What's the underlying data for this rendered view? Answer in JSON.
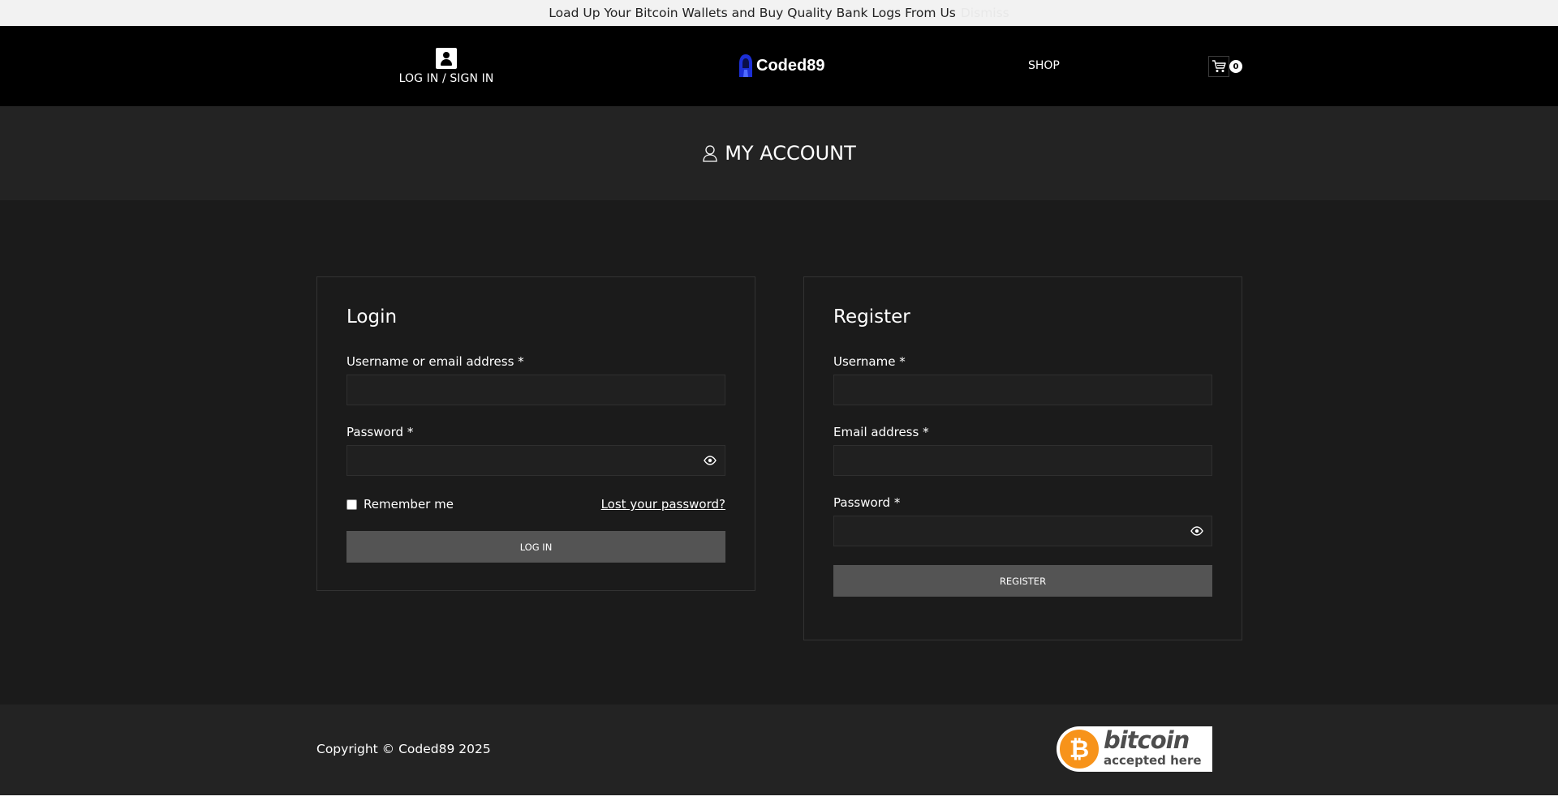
{
  "announcement": {
    "text": "Load Up Your Bitcoin Wallets and Buy Quality Bank Logs From Us",
    "link": "Dismiss"
  },
  "header": {
    "login_label": "LOG IN / SIGN IN",
    "logo_text": "Coded89",
    "shop_label": "SHOP",
    "cart_count": "0"
  },
  "hero": {
    "title": "MY ACCOUNT"
  },
  "login": {
    "heading": "Login",
    "username_label": "Username or email address *",
    "password_label": "Password *",
    "remember_label": "Remember me",
    "lost_password": "Lost your password?",
    "submit": "LOG IN"
  },
  "register": {
    "heading": "Register",
    "username_label": "Username *",
    "email_label": "Email address *",
    "password_label": "Password *",
    "submit": "REGISTER"
  },
  "footer": {
    "copyright": "Copyright © Coded89 2025",
    "badge_word": "bitcoin",
    "badge_sub": "accepted here",
    "badge_symbol": "₿"
  },
  "colors": {
    "accent_button": "#545454",
    "bitcoin_orange": "#f7931a"
  }
}
